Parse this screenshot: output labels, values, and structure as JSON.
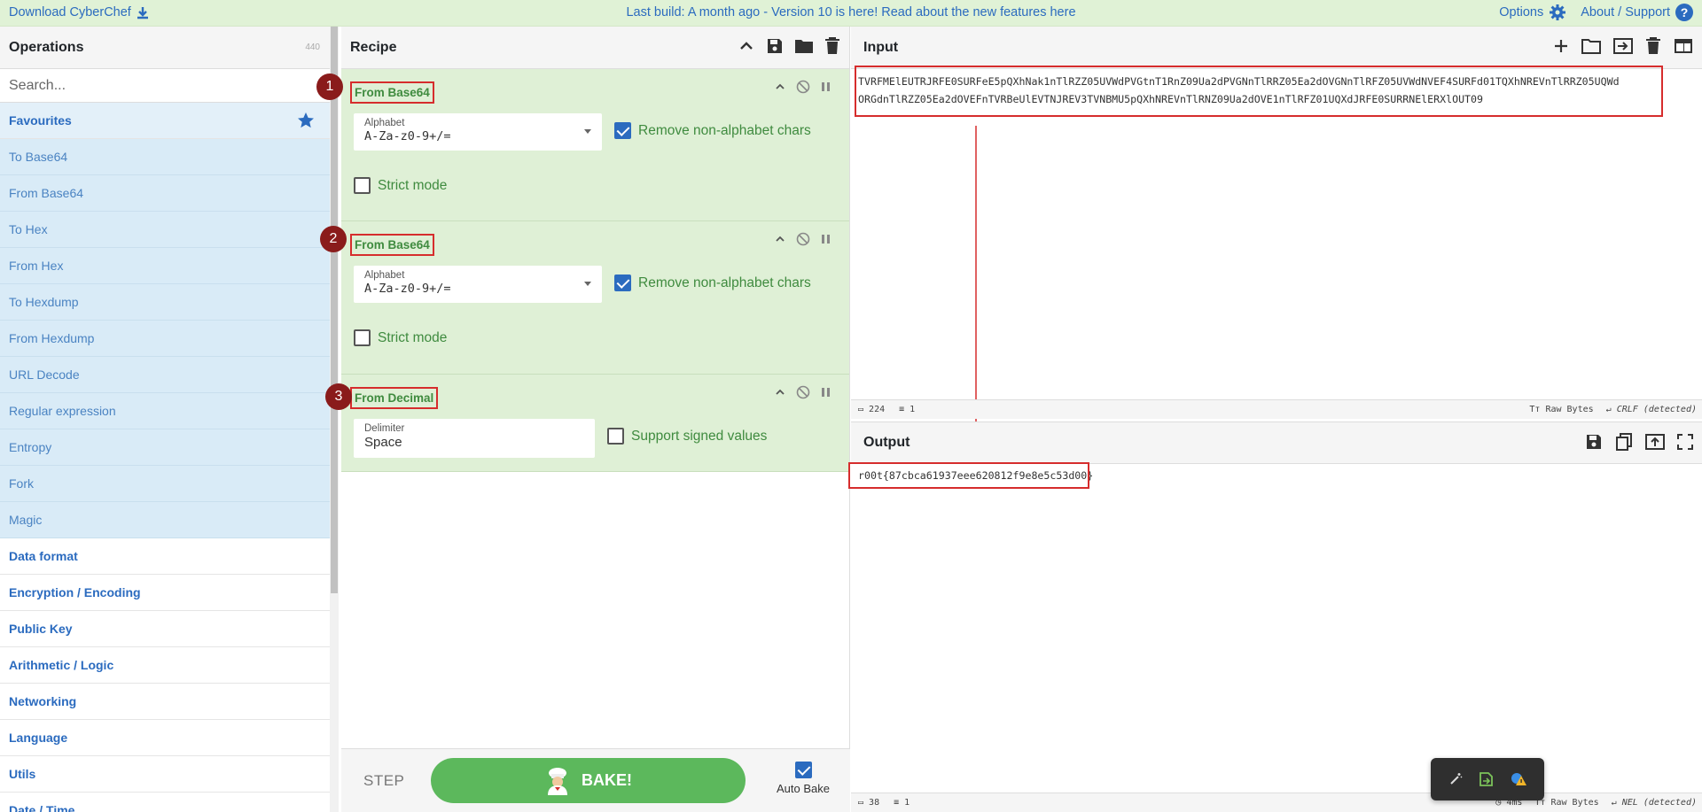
{
  "topbar": {
    "download": "Download CyberChef",
    "notice": "Last build: A month ago - Version 10 is here! Read about the new features here",
    "options": "Options",
    "about": "About / Support"
  },
  "operations": {
    "title": "Operations",
    "count": "440",
    "search_placeholder": "Search...",
    "favourites": "Favourites",
    "items": [
      "To Base64",
      "From Base64",
      "To Hex",
      "From Hex",
      "To Hexdump",
      "From Hexdump",
      "URL Decode",
      "Regular expression",
      "Entropy",
      "Fork",
      "Magic"
    ],
    "categories": [
      "Data format",
      "Encryption / Encoding",
      "Public Key",
      "Arithmetic / Logic",
      "Networking",
      "Language",
      "Utils",
      "Date / Time"
    ]
  },
  "recipe": {
    "title": "Recipe",
    "ops": [
      {
        "badge": "1",
        "name": "From Base64",
        "field_label": "Alphabet",
        "field_value": "A-Za-z0-9+/=",
        "check1": "Remove non-alphabet chars",
        "check2": "Strict mode"
      },
      {
        "badge": "2",
        "name": "From Base64",
        "field_label": "Alphabet",
        "field_value": "A-Za-z0-9+/=",
        "check1": "Remove non-alphabet chars",
        "check2": "Strict mode"
      },
      {
        "badge": "3",
        "name": "From Decimal",
        "field_label": "Delimiter",
        "field_value": "Space",
        "check1": "Support signed values"
      }
    ],
    "step": "STEP",
    "bake": "BAKE!",
    "auto_bake": "Auto Bake"
  },
  "input": {
    "title": "Input",
    "line1": "TVRFMElEUTRJRFE0SURFeE5pQXhNak1nTlRZZ05UVWdPVGtnT1RnZ09Ua2dPVGNnTlRRZ05Ea2dOVGNnTlRFZ05UVWdNVEF4SURFd01TQXhNREVnTlRRZ05UQWd",
    "line2": "ORGdnTlRZZ05Ea2dOVEFnTVRBeUlEVTNJREV3TVNBMU5pQXhNREVnTlRNZ09Ua2dOVE1nTlRFZ01UQXdJRFE0SURRNElERXlOUT09",
    "chars": "224",
    "lines": "1",
    "raw": "Raw Bytes",
    "eol": "CRLF (detected)"
  },
  "output": {
    "title": "Output",
    "text": "r00t{87cbca61937eee620812f9e8e5c53d00}",
    "chars": "38",
    "lines": "1",
    "time": "4ms",
    "raw": "Raw Bytes",
    "eol": "NEL (detected)"
  },
  "colors": {
    "accent": "#2b6bbf",
    "recipe_bg": "#dff0d6",
    "bake": "#5cb85c",
    "highlight": "#d62d2d"
  }
}
